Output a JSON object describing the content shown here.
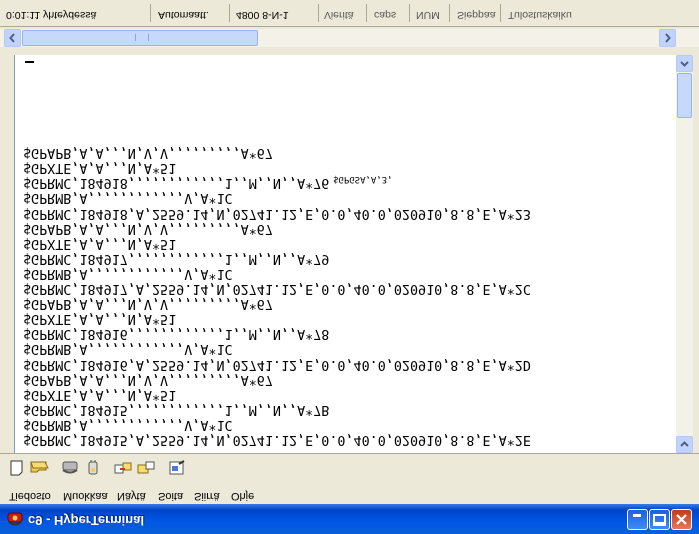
{
  "window": {
    "title": "c9 - HyperTerminal"
  },
  "menu": {
    "items": [
      "Tiedosto",
      "Muokkaa",
      "Näytä",
      "Soita",
      "Siirrä",
      "Ohje"
    ]
  },
  "terminal": {
    "lines": [
      "$GPRMC,184915,A,2559.14,N,02741.12,E,0.0,40.0,020910,8.8,E,A*2E",
      "$GPRMB,A,,,,,,,,,,,,V,A*1C",
      "$GPRMC,184915,,,,,,,,,,,,1,,M,,N,,A*7B",
      "$GPXTE,A,A,,,N,A*51",
      "$GPAPB,A,A,,,N,V,V,,,,,,,,,A*67",
      "$GPRMC,184916,A,2559.14,N,02741.12,E,0.0,40.0,020910,8.8,E,A*2D",
      "$GPRMB,A,,,,,,,,,,,,V,A*1C",
      "$GPRMC,184916,,,,,,,,,,,,1,,M,,N,,A*78",
      "$GPXTE,A,A,,,N,A*51",
      "$GPAPB,A,A,,,N,V,V,,,,,,,,,A*67",
      "$GPRMC,184917,A,2559.14,N,02741.12,E,0.0,40.0,020910,8.8,E,A*2C",
      "$GPRMB,A,,,,,,,,,,,,V,A*1C",
      "$GPRMC,184917,,,,,,,,,,,,1,,M,,N,,A*79",
      "$GPXTE,A,A,,,N,A*51",
      "$GPAPB,A,A,,,N,V,V,,,,,,,,,A*67",
      "$GPRMC,184918,A,2559.14,N,02741.12,E,0.0,40.0,020910,8.8,E,A*23",
      "$GPRMB,A,,,,,,,,,,,,V,A*1C",
      "$GPRMC,184918,,,,,,,,,,,,1,,M,,N,,A*76",
      "$GPXTE,A,A,,,N,A*51",
      "$GPAPB,A,A,,,N,V,V,,,,,,,,,A*67"
    ],
    "overlay": "$GPGSA,A,3,"
  },
  "status": {
    "connected": "0:01:11 yhteydessä",
    "detect": "Automaatt.",
    "params": "4800 8-N-1",
    "scroll": "Vieritä",
    "caps": "caps",
    "num": "NUM",
    "capture": "Sieppaa",
    "print": "Tulostuskaiku"
  },
  "colors": {
    "titlebar": "#0058e6",
    "chrome": "#ece9d8",
    "scroll_button": "#c1d3fb"
  }
}
